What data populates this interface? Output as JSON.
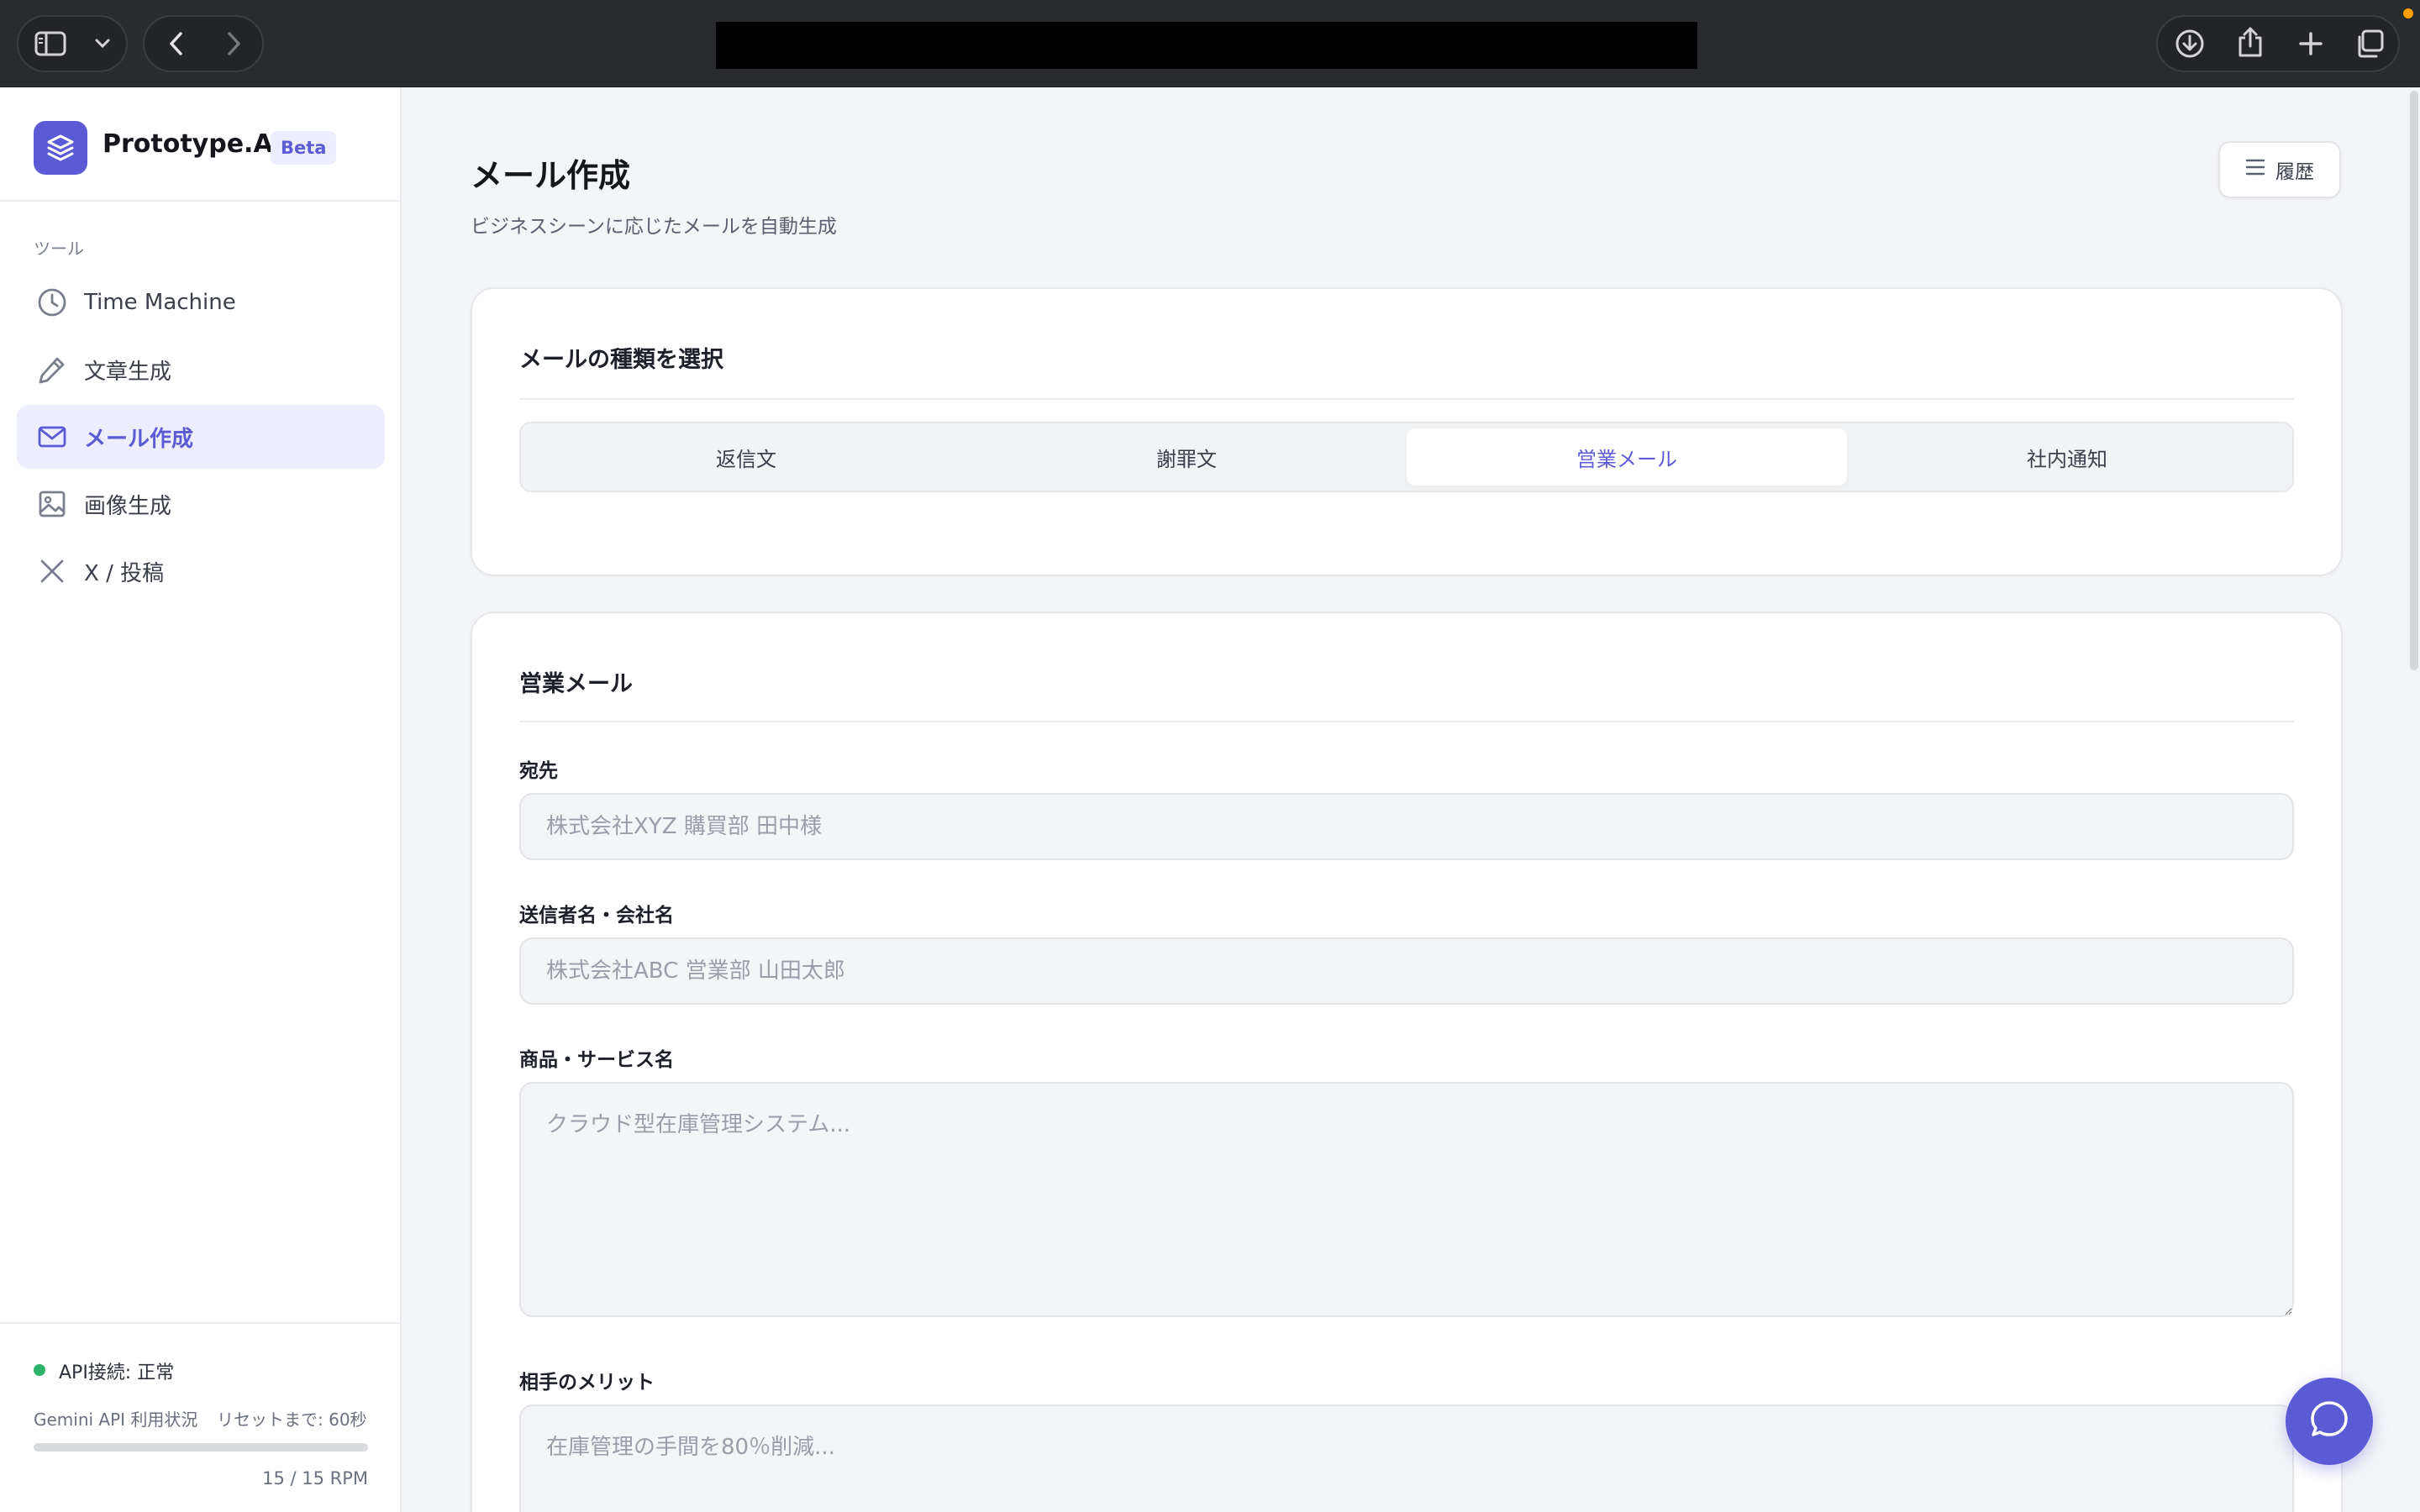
{
  "browser": {
    "icons": [
      "sidebar-toggle-icon",
      "chevron-down-icon",
      "back-icon",
      "forward-icon",
      "download-icon",
      "share-icon",
      "new-tab-icon",
      "tabs-overview-icon"
    ]
  },
  "sidebar": {
    "brand_name": "Prototype.AI",
    "beta_badge": "Beta",
    "section_label": "ツール",
    "items": [
      {
        "label": "Time Machine",
        "icon": "clock-icon",
        "active": false
      },
      {
        "label": "文章生成",
        "icon": "pencil-icon",
        "active": false
      },
      {
        "label": "メール作成",
        "icon": "mail-icon",
        "active": true
      },
      {
        "label": "画像生成",
        "icon": "image-icon",
        "active": false
      },
      {
        "label": "X / 投稿",
        "icon": "x-icon",
        "active": false
      }
    ],
    "footer": {
      "api_status": "API接続: 正常",
      "usage_label": "Gemini API 利用状況",
      "reset_label": "リセットまで: 60秒",
      "usage_count": "15 / 15 RPM",
      "usage_fraction": 1.0
    }
  },
  "main": {
    "title": "メール作成",
    "subtitle": "ビジネスシーンに応じたメールを自動生成",
    "history_button": "履歴",
    "type_card": {
      "title": "メールの種類を選択",
      "tabs": [
        "返信文",
        "謝罪文",
        "営業メール",
        "社内通知"
      ],
      "active_tab": "営業メール"
    },
    "form_card": {
      "title": "営業メール",
      "fields": [
        {
          "label": "宛先",
          "placeholder": "株式会社XYZ 購買部 田中様",
          "value": ""
        },
        {
          "label": "送信者名・会社名",
          "placeholder": "株式会社ABC 営業部 山田太郎",
          "value": ""
        },
        {
          "label": "商品・サービス名",
          "placeholder": "クラウド型在庫管理システム...",
          "value": ""
        },
        {
          "label": "相手のメリット",
          "placeholder": "在庫管理の手間を80％削減...",
          "value": ""
        }
      ]
    }
  },
  "colors": {
    "accent": "#5b5bd6",
    "accent_soft": "#eceefe",
    "status_ok": "#2fb36b",
    "chrome_bg": "#2a2b2e"
  }
}
